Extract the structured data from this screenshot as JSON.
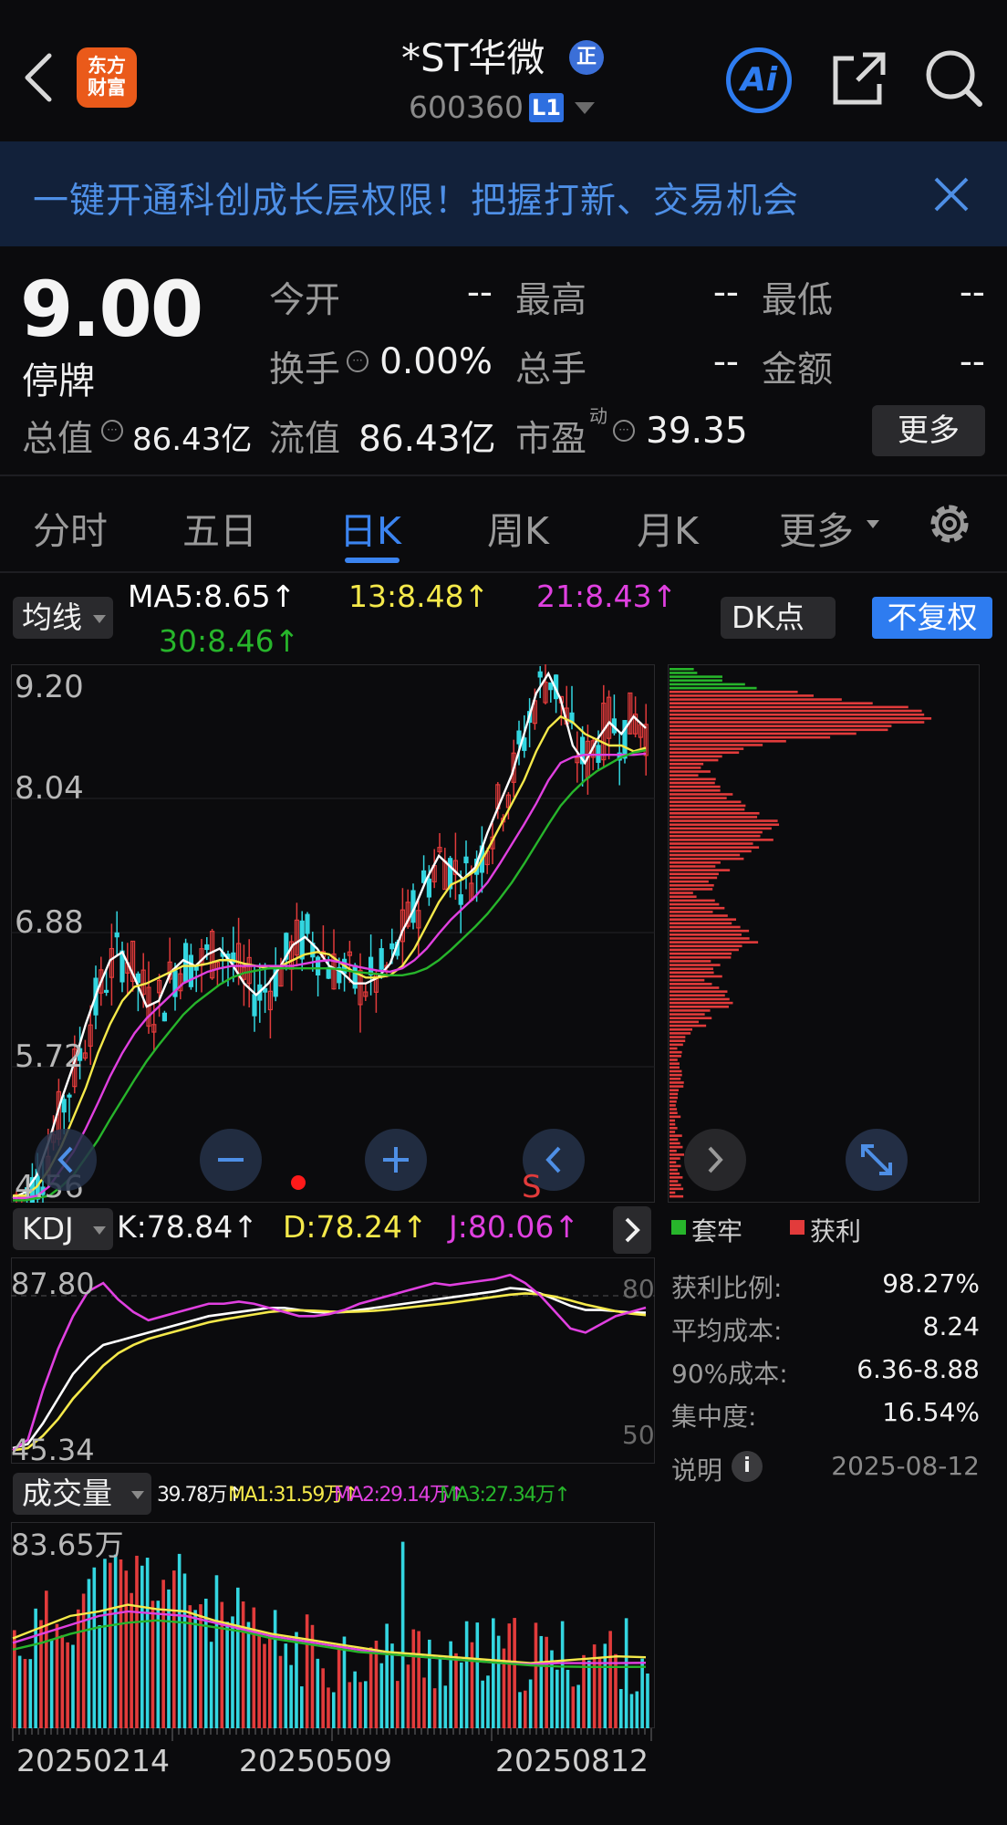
{
  "header": {
    "logo_line1": "东方",
    "logo_line2": "财富",
    "title": "*ST华微",
    "title_badge": "正",
    "code": "600360",
    "level_badge": "L1",
    "ai_label": "Ai"
  },
  "banner": {
    "text": "一键开通科创成长层权限！把握打新、交易机会"
  },
  "quote": {
    "price": "9.00",
    "status": "停牌",
    "rows": [
      [
        {
          "label": "今开",
          "value": "--"
        },
        {
          "label": "最高",
          "value": "--"
        },
        {
          "label": "最低",
          "value": "--"
        }
      ],
      [
        {
          "label": "换手",
          "value": "0.00%"
        },
        {
          "label": "总手",
          "value": "--"
        },
        {
          "label": "金额",
          "value": "--"
        }
      ]
    ],
    "total_value_label": "总值",
    "total_value": "86.43亿",
    "float_value_label": "流值",
    "float_value": "86.43亿",
    "pe_label": "市盈",
    "pe_sup": "动",
    "pe_value": "39.35",
    "more_label": "更多"
  },
  "tabs": [
    {
      "label": "分时",
      "active": false
    },
    {
      "label": "五日",
      "active": false
    },
    {
      "label": "日K",
      "active": true
    },
    {
      "label": "周K",
      "active": false
    },
    {
      "label": "月K",
      "active": false
    },
    {
      "label": "更多",
      "active": false
    }
  ],
  "chart": {
    "ma_dropdown": "均线",
    "ma5": "MA5:8.65↑",
    "ma13": "13:8.48↑",
    "ma21": "21:8.43↑",
    "ma30": "30:8.46↑",
    "dk_button": "DK点",
    "adjust_button": "不复权",
    "price_ticks": [
      "9.20",
      "8.04",
      "6.88",
      "5.72",
      "4.56"
    ],
    "kdj_dropdown": "KDJ",
    "kdj_k": "K:78.84↑",
    "kdj_d": "D:78.24↑",
    "kdj_j": "J:80.06↑",
    "kdj_ticks": [
      "87.80",
      "45.34"
    ],
    "kdj_ref_80": "80",
    "kdj_ref_50": "50",
    "vol_dropdown": "成交量",
    "vol_now": "39.78万↑",
    "vol_ma1": "MA1:31.59万↑",
    "vol_ma2": "MA2:29.14万↑",
    "vol_ma3": "MA3:27.34万↑",
    "vol_tick": "83.65万",
    "dates": [
      "20250214",
      "20250509",
      "20250812"
    ],
    "sell_marker": "S",
    "colors": {
      "up": "#e23b3b",
      "down": "#33d6e0",
      "ma5": "#ffffff",
      "ma13": "#f5e94a",
      "ma21": "#e040e0",
      "ma30": "#27b52b",
      "accent": "#2e7cf0"
    }
  },
  "chips": {
    "legend_trapped": "套牢",
    "legend_profit": "获利",
    "stats": [
      {
        "label": "获利比例:",
        "value": "98.27%"
      },
      {
        "label": "平均成本:",
        "value": "8.24"
      },
      {
        "label": "90%成本:",
        "value": "6.36-8.88"
      },
      {
        "label": "集中度:",
        "value": "16.54%"
      }
    ],
    "note_label": "说明",
    "date": "2025-08-12"
  },
  "chart_data": [
    {
      "type": "candlestick",
      "title": "日K",
      "ylim": [
        4.56,
        9.2
      ],
      "series": [
        {
          "name": "MA5",
          "values": [
            4.6,
            4.65,
            4.8,
            5.1,
            5.45,
            5.75,
            6.1,
            6.4,
            6.65,
            6.72,
            6.5,
            6.25,
            6.3,
            6.55,
            6.65,
            6.6,
            6.7,
            6.75,
            6.62,
            6.45,
            6.35,
            6.45,
            6.6,
            6.78,
            6.85,
            6.75,
            6.6,
            6.55,
            6.45,
            6.45,
            6.5,
            6.62,
            6.9,
            7.1,
            7.35,
            7.55,
            7.45,
            7.35,
            7.45,
            7.75,
            8.0,
            8.25,
            8.6,
            8.95,
            9.12,
            8.9,
            8.5,
            8.35,
            8.55,
            8.7,
            8.6,
            8.75,
            8.65
          ]
        },
        {
          "name": "13",
          "values": [
            4.62,
            4.62,
            4.7,
            4.85,
            5.05,
            5.3,
            5.55,
            5.85,
            6.1,
            6.3,
            6.42,
            6.45,
            6.5,
            6.55,
            6.6,
            6.6,
            6.62,
            6.65,
            6.65,
            6.62,
            6.6,
            6.58,
            6.6,
            6.65,
            6.7,
            6.72,
            6.7,
            6.62,
            6.55,
            6.5,
            6.5,
            6.52,
            6.6,
            6.75,
            6.95,
            7.15,
            7.3,
            7.35,
            7.42,
            7.6,
            7.8,
            8.0,
            8.2,
            8.45,
            8.65,
            8.75,
            8.7,
            8.6,
            8.55,
            8.5,
            8.5,
            8.45,
            8.48
          ]
        },
        {
          "name": "21",
          "values": [
            4.6,
            4.6,
            4.62,
            4.7,
            4.85,
            5.0,
            5.2,
            5.42,
            5.65,
            5.85,
            6.02,
            6.15,
            6.25,
            6.35,
            6.45,
            6.5,
            6.55,
            6.58,
            6.6,
            6.6,
            6.6,
            6.6,
            6.6,
            6.6,
            6.62,
            6.64,
            6.65,
            6.63,
            6.6,
            6.58,
            6.56,
            6.55,
            6.58,
            6.65,
            6.75,
            6.88,
            7.0,
            7.1,
            7.2,
            7.32,
            7.48,
            7.65,
            7.82,
            8.0,
            8.2,
            8.35,
            8.4,
            8.42,
            8.42,
            8.42,
            8.42,
            8.42,
            8.43
          ]
        },
        {
          "name": "30",
          "values": [
            4.58,
            4.58,
            4.6,
            4.62,
            4.7,
            4.8,
            4.95,
            5.1,
            5.28,
            5.45,
            5.62,
            5.78,
            5.92,
            6.05,
            6.18,
            6.28,
            6.36,
            6.44,
            6.5,
            6.54,
            6.56,
            6.58,
            6.58,
            6.58,
            6.58,
            6.58,
            6.58,
            6.57,
            6.55,
            6.54,
            6.53,
            6.52,
            6.52,
            6.54,
            6.58,
            6.65,
            6.74,
            6.84,
            6.94,
            7.05,
            7.18,
            7.32,
            7.48,
            7.65,
            7.82,
            7.98,
            8.1,
            8.2,
            8.28,
            8.34,
            8.4,
            8.44,
            8.46
          ]
        }
      ]
    },
    {
      "type": "line",
      "title": "KDJ",
      "ylim": [
        45.34,
        87.8
      ],
      "series": [
        {
          "name": "K",
          "values": [
            46,
            47,
            52,
            58,
            64,
            68,
            71,
            72,
            73,
            74,
            75,
            76,
            77,
            78,
            78.5,
            79,
            79.5,
            80,
            80,
            79.5,
            79,
            78.8,
            79,
            79.5,
            80,
            80.5,
            81,
            81.5,
            82,
            82.5,
            83,
            83.5,
            84,
            84.8,
            84.5,
            83.5,
            82,
            80.5,
            79.5,
            79.5,
            79.2,
            78.9,
            78.84
          ]
        },
        {
          "name": "D",
          "values": [
            45.5,
            46,
            49,
            53,
            58,
            62,
            66,
            69,
            71,
            72.5,
            73.5,
            74.5,
            75.5,
            76.5,
            77.2,
            77.8,
            78.4,
            79,
            79.3,
            79.4,
            79.3,
            79.1,
            79,
            79.1,
            79.3,
            79.6,
            80,
            80.4,
            80.8,
            81.2,
            81.7,
            82.2,
            82.7,
            83.2,
            83.5,
            83.3,
            82.7,
            81.8,
            80.8,
            80,
            79.2,
            78.6,
            78.24
          ]
        },
        {
          "name": "J",
          "values": [
            45.5,
            48,
            60,
            70,
            78,
            84,
            86,
            82,
            79,
            77,
            78,
            79,
            80,
            81,
            81,
            81.5,
            81,
            80,
            79,
            78,
            78,
            78.5,
            79.5,
            81,
            82,
            83,
            84,
            85,
            86,
            85.5,
            86,
            86.5,
            87,
            88,
            86,
            83,
            79,
            75,
            74,
            76,
            78,
            79,
            80.06
          ]
        }
      ]
    },
    {
      "type": "bar",
      "title": "成交量",
      "ylim": [
        0,
        83.65
      ],
      "series": [
        {
          "name": "MA1",
          "values": [
            40,
            45,
            50,
            52,
            55,
            53,
            52,
            48,
            45,
            42,
            40,
            38,
            36,
            34,
            33,
            32,
            31,
            30,
            29,
            30,
            31,
            32,
            31.59
          ]
        },
        {
          "name": "MA2",
          "values": [
            38,
            42,
            46,
            50,
            52,
            51,
            50,
            47,
            44,
            41,
            39,
            37,
            35,
            33,
            32,
            31,
            30,
            29,
            28.5,
            29,
            29,
            29,
            29.14
          ]
        },
        {
          "name": "MA3",
          "values": [
            35,
            38,
            42,
            45,
            47,
            48,
            47,
            45,
            43,
            40,
            38,
            36,
            34,
            33,
            32,
            31,
            30,
            29,
            28,
            27.5,
            27.3,
            27.3,
            27.34
          ]
        }
      ]
    }
  ]
}
